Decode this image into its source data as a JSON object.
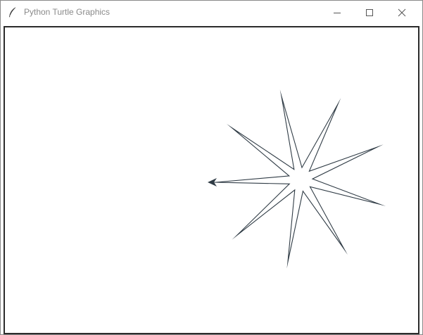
{
  "window": {
    "title": "Python Turtle Graphics",
    "app_icon": "feather-icon",
    "controls": {
      "minimize_icon": "minimize-icon",
      "maximize_icon": "maximize-icon",
      "close_icon": "close-icon"
    }
  },
  "canvas": {
    "background_color": "#ffffff",
    "pen_color": "#2f3b45",
    "shape": "nine-pointed-star",
    "turtle_icon": "turtle-arrow-icon"
  }
}
